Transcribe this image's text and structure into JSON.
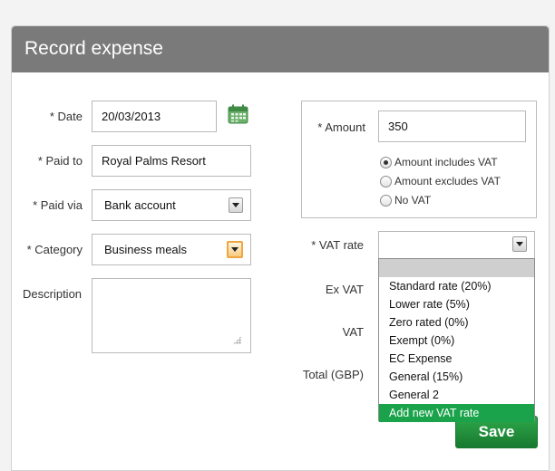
{
  "header": {
    "title": "Record expense"
  },
  "form": {
    "date": {
      "label": "* Date",
      "value": "20/03/2013"
    },
    "paid_to": {
      "label": "* Paid to",
      "value": "Royal Palms Resort"
    },
    "paid_via": {
      "label": "* Paid via",
      "value": "Bank account"
    },
    "category": {
      "label": "* Category",
      "value": "Business meals"
    },
    "description": {
      "label": "Description",
      "value": ""
    }
  },
  "amount": {
    "label": "* Amount",
    "value": "350",
    "vat_options": [
      {
        "label": "Amount includes VAT",
        "checked": true
      },
      {
        "label": "Amount excludes VAT",
        "checked": false
      },
      {
        "label": "No VAT",
        "checked": false
      }
    ]
  },
  "vat_rate": {
    "label": "* VAT rate",
    "options": [
      "Standard rate (20%)",
      "Lower rate (5%)",
      "Zero rated (0%)",
      "Exempt (0%)",
      "EC Expense",
      "General (15%)",
      "General 2",
      "Add new VAT rate"
    ],
    "highlighted_option": "Add new VAT rate"
  },
  "totals": {
    "ex_vat_label": "Ex VAT",
    "vat_label": "VAT",
    "total_label": "Total (GBP)"
  },
  "save_label": "Save",
  "colors": {
    "header_bg": "#7a7a7a",
    "highlight_green": "#1aa34a",
    "save_green": "#22913e"
  }
}
